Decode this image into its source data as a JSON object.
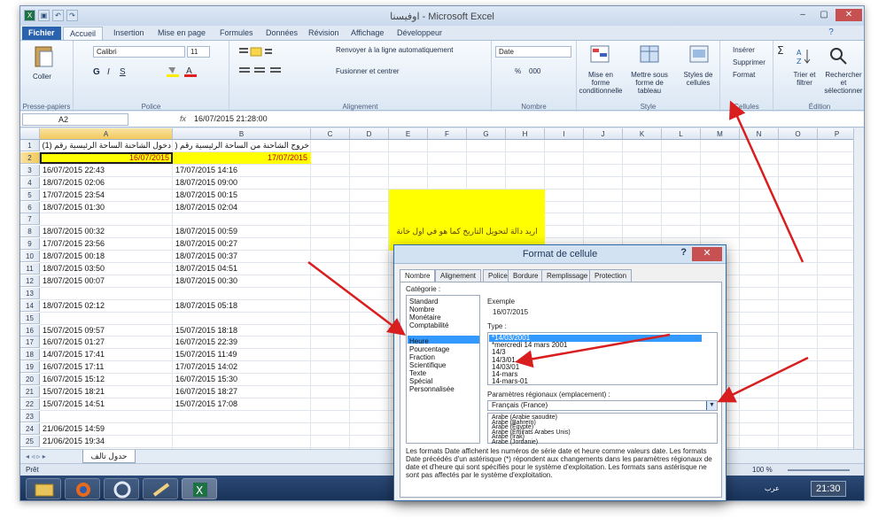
{
  "window": {
    "title": "اوفيسنا - Microsoft Excel",
    "accent": "#2a62ad"
  },
  "tabs": [
    "Fichier",
    "Accueil",
    "Insertion",
    "Mise en page",
    "Formules",
    "Données",
    "Révision",
    "Affichage",
    "Développeur"
  ],
  "ribbon": {
    "clipboard": {
      "paste": "Coller",
      "label": "Presse-papiers"
    },
    "font": {
      "name": "Calibri",
      "size": "11",
      "label": "Police",
      "bold": "G",
      "italic": "I",
      "underline": "S"
    },
    "alignment": {
      "wrap": "Renvoyer à la ligne automatiquement",
      "merge": "Fusionner et centrer",
      "label": "Alignement"
    },
    "number": {
      "format": "Date",
      "percent": "%",
      "thousands": "000",
      "label": "Nombre"
    },
    "styles": {
      "conditional": "Mise en forme conditionnelle",
      "table": "Mettre sous forme de tableau",
      "cell": "Styles de cellules",
      "label": "Style"
    },
    "cells": {
      "insert": "Insérer",
      "delete": "Supprimer",
      "format": "Format",
      "label": "Cellules"
    },
    "editing": {
      "sort": "Trier et filtrer",
      "find": "Rechercher et sélectionner",
      "label": "Édition"
    }
  },
  "formula_bar": {
    "cell_ref": "A2",
    "fx": "fx",
    "value": "16/07/2015 21:28:00"
  },
  "columns": [
    "A",
    "B",
    "C",
    "D",
    "E",
    "F",
    "G",
    "H",
    "I",
    "J",
    "K",
    "L",
    "M",
    "N",
    "O",
    "P"
  ],
  "rows": [
    "1",
    "2",
    "3",
    "4",
    "5",
    "6",
    "7",
    "8",
    "9",
    "10",
    "11",
    "12",
    "13",
    "14",
    "15",
    "16",
    "17",
    "18",
    "19",
    "20",
    "21",
    "22",
    "23",
    "24",
    "25"
  ],
  "cells": {
    "A1": "دخول الشاحنة الساحة الرئيسية رقم (1)",
    "B1": "خروج الشاحنة من الساحة الرئيسية رقم (1)",
    "A2": "16/07/2015",
    "B2": "17/07/2015",
    "A": [
      "",
      "",
      "16/07/2015 22:43",
      "18/07/2015 02:06",
      "17/07/2015 23:54",
      "18/07/2015 01:30",
      "",
      "18/07/2015 00:32",
      "17/07/2015 23:56",
      "18/07/2015 00:18",
      "18/07/2015 03:50",
      "18/07/2015 00:07",
      "",
      "18/07/2015 02:12",
      "",
      "15/07/2015 09:57",
      "16/07/2015 01:27",
      "14/07/2015 17:41",
      "16/07/2015 17:11",
      "16/07/2015 15:12",
      "15/07/2015 18:21",
      "15/07/2015 14:51",
      "",
      "21/06/2015 14:59",
      "21/06/2015 19:34"
    ],
    "B": [
      "",
      "",
      "17/07/2015 14:16",
      "18/07/2015 09:00",
      "18/07/2015 00:15",
      "18/07/2015 02:04",
      "",
      "18/07/2015 00:59",
      "18/07/2015 00:27",
      "18/07/2015 00:37",
      "18/07/2015 04:51",
      "18/07/2015 00:30",
      "",
      "18/07/2015 05:18",
      "",
      "15/07/2015 18:18",
      "16/07/2015 22:39",
      "15/07/2015 11:49",
      "17/07/2015 14:02",
      "16/07/2015 15:30",
      "16/07/2015 18:27",
      "15/07/2015 17:08",
      "",
      "",
      ""
    ],
    "note": "اريد دالة لتحويل التاريخ كما هو في اول خانة"
  },
  "sheet": {
    "tab": "حدول تالف",
    "status": "Prêt",
    "zoom": "100 %"
  },
  "taskbar": {
    "lang": "عرب",
    "clock": "21:30"
  },
  "dialog": {
    "title": "Format de cellule",
    "help": "?",
    "close": "✕",
    "tabs": [
      "Nombre",
      "Alignement",
      "Police",
      "Bordure",
      "Remplissage",
      "Protection"
    ],
    "category_label": "Catégorie :",
    "categories": [
      "Standard",
      "Nombre",
      "Monétaire",
      "Comptabilité",
      "Date",
      "Heure",
      "Pourcentage",
      "Fraction",
      "Scientifique",
      "Texte",
      "Spécial",
      "Personnalisée"
    ],
    "sample_label": "Exemple",
    "sample": "16/07/2015",
    "type_label": "Type :",
    "types": [
      "*14/03/2001",
      "*mercredi 14 mars 2001",
      "14/3",
      "14/3/01",
      "14/03/01",
      "14-mars",
      "14-mars-01"
    ],
    "locale_label": "Paramètres régionaux (emplacement) :",
    "locale": "Français (France)",
    "locales": [
      "Arabe (Arabie saoudite)",
      "Arabe (Bahreïn)",
      "Arabe (Égypte)",
      "Arabe (Émirats Arabes Unis)",
      "Arabe (Irak)",
      "Arabe (Jordanie)"
    ],
    "description": "Les formats Date affichent les numéros de série date et heure comme valeurs date. Les formats Date précédés d'un astérisque (*) répondent aux changements dans les paramètres régionaux de date et d'heure qui sont spécifiés pour le système d'exploitation. Les formats sans astérisque ne sont pas affectés par le système d'exploitation."
  }
}
